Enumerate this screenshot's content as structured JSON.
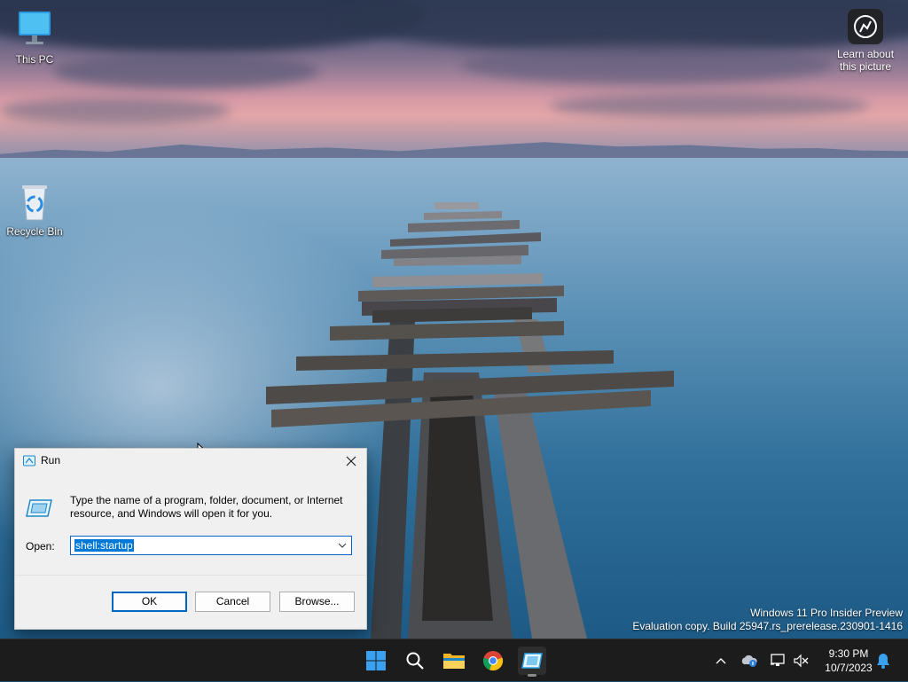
{
  "desktop": {
    "icons": [
      {
        "label": "This PC"
      },
      {
        "label": "Recycle Bin"
      }
    ],
    "learn_about": "Learn about this picture",
    "watermark": {
      "line1": "Windows 11 Pro Insider Preview",
      "line2": "Evaluation copy. Build 25947.rs_prerelease.230901-1416"
    }
  },
  "run_dialog": {
    "title": "Run",
    "description": "Type the name of a program, folder, document, or Internet resource, and Windows will open it for you.",
    "open_label": "Open:",
    "open_value": "shell:startup",
    "buttons": {
      "ok": "OK",
      "cancel": "Cancel",
      "browse": "Browse..."
    }
  },
  "taskbar": {
    "apps": [
      {
        "icon": "windows-start-icon"
      },
      {
        "icon": "search-icon"
      },
      {
        "icon": "file-explorer-icon"
      },
      {
        "icon": "chrome-icon"
      },
      {
        "icon": "run-app-icon",
        "active": true
      }
    ],
    "tray": [
      "chevron-up-icon",
      "onedrive-icon",
      "network-icon",
      "volume-muted-icon"
    ],
    "time": "9:30 PM",
    "date": "10/7/2023",
    "notification_icon": "bell-icon"
  },
  "colors": {
    "accent": "#0078d7",
    "taskbar": "#1c1c1c",
    "dialog_bg": "#f0f0f0"
  }
}
